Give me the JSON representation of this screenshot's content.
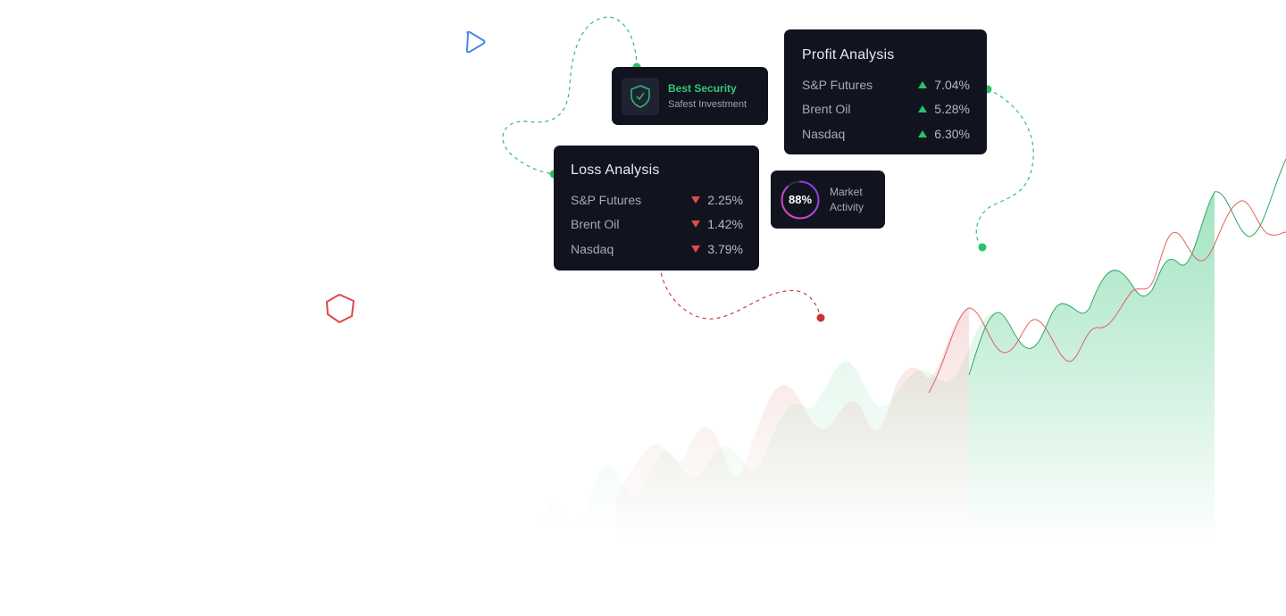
{
  "profit_analysis": {
    "title": "Profit Analysis",
    "rows": [
      {
        "name": "S&P Futures",
        "value": "7.04%",
        "direction": "up"
      },
      {
        "name": "Brent Oil",
        "value": "5.28%",
        "direction": "up"
      },
      {
        "name": "Nasdaq",
        "value": "6.30%",
        "direction": "up"
      }
    ]
  },
  "loss_analysis": {
    "title": "Loss Analysis",
    "rows": [
      {
        "name": "S&P Futures",
        "value": "2.25%",
        "direction": "down"
      },
      {
        "name": "Brent Oil",
        "value": "1.42%",
        "direction": "down"
      },
      {
        "name": "Nasdaq",
        "value": "3.79%",
        "direction": "down"
      }
    ]
  },
  "security": {
    "title": "Best Security",
    "subtitle": "Safest Investment",
    "icon": "shield-check-icon"
  },
  "market": {
    "percent": "88%",
    "progress": 0.88,
    "label": "Market Activity"
  },
  "decor_icons": [
    "play-outline-icon",
    "pentagon-outline-icon"
  ],
  "colors": {
    "card_bg": "#11141f",
    "profit_green": "#27c26c",
    "loss_red": "#e14a4a",
    "play_blue": "#4a86e8",
    "pentagon_red": "#e0474c",
    "ring_gradient_start": "#e44bbf",
    "ring_gradient_end": "#7b3bf0"
  }
}
